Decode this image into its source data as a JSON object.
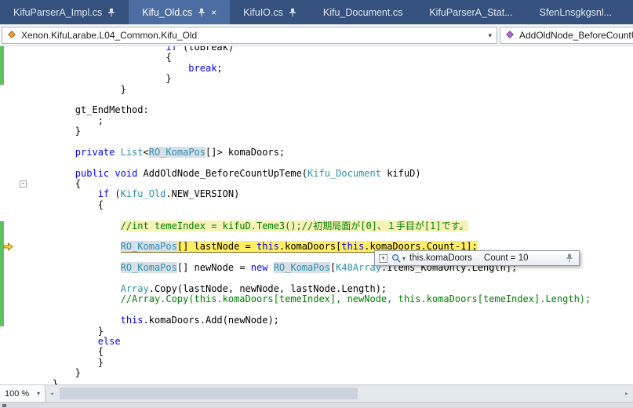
{
  "colors": {
    "tabbar_bg": "#35527E",
    "activetab_bg": "#4C6DA1",
    "keyword": "#0000FF",
    "type": "#2B91AF",
    "comment": "#008000",
    "plain": "#000000",
    "current_line_bg": "#FFEE62",
    "comment_line_bg": "#F7F2B8",
    "symbol_highlight_bg": "#D8DFE6",
    "change_bar": "#5EC05E"
  },
  "icons": {
    "close_glyph": "×",
    "caret_glyph": "▾",
    "collapse_glyph": "-",
    "expand_glyph": "+",
    "scroll_left_glyph": "◂",
    "scroll_right_glyph": "▸"
  },
  "tabs": [
    {
      "label": "KifuParserA_Impl.cs",
      "pinned": true,
      "active": false,
      "closable": false
    },
    {
      "label": "Kifu_Old.cs",
      "pinned": true,
      "active": true,
      "closable": true
    },
    {
      "label": "KifuIO.cs",
      "pinned": true,
      "active": false,
      "closable": false
    },
    {
      "label": "Kifu_Document.cs",
      "pinned": false,
      "active": false,
      "closable": false
    },
    {
      "label": "KifuParserA_Stat...",
      "pinned": false,
      "active": false,
      "closable": false
    },
    {
      "label": "SfenLnsgkgsnl...",
      "pinned": false,
      "active": false,
      "closable": false
    }
  ],
  "navbar": {
    "type_path": "Xenon.KifuLarabe.L04_Common.Kifu_Old",
    "member_name": "AddOldNode_BeforeCountU..."
  },
  "editor": {
    "lines": [
      {
        "indent": 24,
        "segs": [
          [
            "k",
            "if"
          ],
          [
            "p",
            " (toBreak)"
          ]
        ],
        "changed": true
      },
      {
        "indent": 24,
        "segs": [
          [
            "p",
            "{"
          ]
        ],
        "changed": true
      },
      {
        "indent": 28,
        "segs": [
          [
            "k",
            "break"
          ],
          [
            "p",
            ";"
          ]
        ],
        "changed": true
      },
      {
        "indent": 24,
        "segs": [
          [
            "p",
            "}"
          ]
        ],
        "changed": true
      },
      {
        "indent": 16,
        "segs": [
          [
            "p",
            "}"
          ]
        ]
      },
      {
        "indent": 0,
        "segs": []
      },
      {
        "indent": 8,
        "segs": [
          [
            "p",
            "gt_EndMethod:"
          ]
        ]
      },
      {
        "indent": 12,
        "segs": [
          [
            "p",
            ";"
          ]
        ]
      },
      {
        "indent": 8,
        "segs": [
          [
            "p",
            "}"
          ]
        ]
      },
      {
        "indent": 0,
        "segs": []
      },
      {
        "indent": 8,
        "segs": [
          [
            "k",
            "private"
          ],
          [
            "p",
            " "
          ],
          [
            "t",
            "List"
          ],
          [
            "p",
            "<"
          ],
          [
            "ts",
            "RO_KomaPos"
          ],
          [
            "p",
            "[]> komaDoors;"
          ]
        ]
      },
      {
        "indent": 0,
        "segs": []
      },
      {
        "indent": 8,
        "segs": [
          [
            "k",
            "public"
          ],
          [
            "p",
            " "
          ],
          [
            "k",
            "void"
          ],
          [
            "p",
            " AddOldNode_BeforeCountUpTeme("
          ],
          [
            "t",
            "Kifu_Document"
          ],
          [
            "p",
            " kifuD)"
          ]
        ]
      },
      {
        "indent": 8,
        "segs": [
          [
            "p",
            "{"
          ]
        ],
        "fold": true
      },
      {
        "indent": 12,
        "segs": [
          [
            "k",
            "if"
          ],
          [
            "p",
            " ("
          ],
          [
            "t",
            "Kifu_Old"
          ],
          [
            "p",
            ".NEW_VERSION)"
          ]
        ]
      },
      {
        "indent": 12,
        "segs": [
          [
            "p",
            "{"
          ]
        ]
      },
      {
        "indent": 0,
        "segs": []
      },
      {
        "indent": 16,
        "segs": [
          [
            "c",
            "//int temeIndex = kifuD.Teme3();//初期局面が[0]、１手目が[1]です。"
          ]
        ],
        "bg": "pale",
        "changed": true
      },
      {
        "indent": 0,
        "segs": [],
        "changed": true
      },
      {
        "indent": 16,
        "segs": [
          [
            "ts",
            "RO_KomaPos"
          ],
          [
            "p",
            "[] lastNode = "
          ],
          [
            "k",
            "this"
          ],
          [
            "p",
            ".komaDoors["
          ],
          [
            "k",
            "this"
          ],
          [
            "p",
            ".komaDoors.Count-1];"
          ]
        ],
        "bg": "current",
        "changed": true,
        "glyph": "arrow"
      },
      {
        "indent": 0,
        "segs": [],
        "changed": true
      },
      {
        "indent": 16,
        "segs": [
          [
            "ts",
            "RO_KomaPos"
          ],
          [
            "p",
            "[] newNode = "
          ],
          [
            "k",
            "new"
          ],
          [
            "p",
            " "
          ],
          [
            "ts",
            "RO_KomaPos"
          ],
          [
            "p",
            "["
          ],
          [
            "t",
            "K40Array"
          ],
          [
            "p",
            ".Items_KomaOnly.Length];"
          ]
        ],
        "changed": true
      },
      {
        "indent": 0,
        "segs": [],
        "changed": true
      },
      {
        "indent": 16,
        "segs": [
          [
            "t",
            "Array"
          ],
          [
            "p",
            ".Copy(lastNode, newNode, lastNode.Length);"
          ]
        ],
        "changed": true
      },
      {
        "indent": 16,
        "segs": [
          [
            "c",
            "//Array.Copy(this.komaDoors[temeIndex], newNode, this.komaDoors[temeIndex].Length);"
          ]
        ],
        "changed": true
      },
      {
        "indent": 0,
        "segs": [],
        "changed": true
      },
      {
        "indent": 16,
        "segs": [
          [
            "k",
            "this"
          ],
          [
            "p",
            ".komaDoors.Add(newNode);"
          ]
        ],
        "changed": true
      },
      {
        "indent": 12,
        "segs": [
          [
            "p",
            "}"
          ]
        ]
      },
      {
        "indent": 12,
        "segs": [
          [
            "k",
            "else"
          ]
        ]
      },
      {
        "indent": 12,
        "segs": [
          [
            "p",
            "{"
          ]
        ]
      },
      {
        "indent": 12,
        "segs": [
          [
            "p",
            "}"
          ]
        ]
      },
      {
        "indent": 8,
        "segs": [
          [
            "p",
            "}"
          ]
        ]
      },
      {
        "indent": 4,
        "segs": [
          [
            "p",
            "}"
          ]
        ]
      }
    ]
  },
  "datatip": {
    "expression": "this.komaDoors",
    "value": "Count = 10"
  },
  "statusbar": {
    "zoom": "100 %"
  }
}
